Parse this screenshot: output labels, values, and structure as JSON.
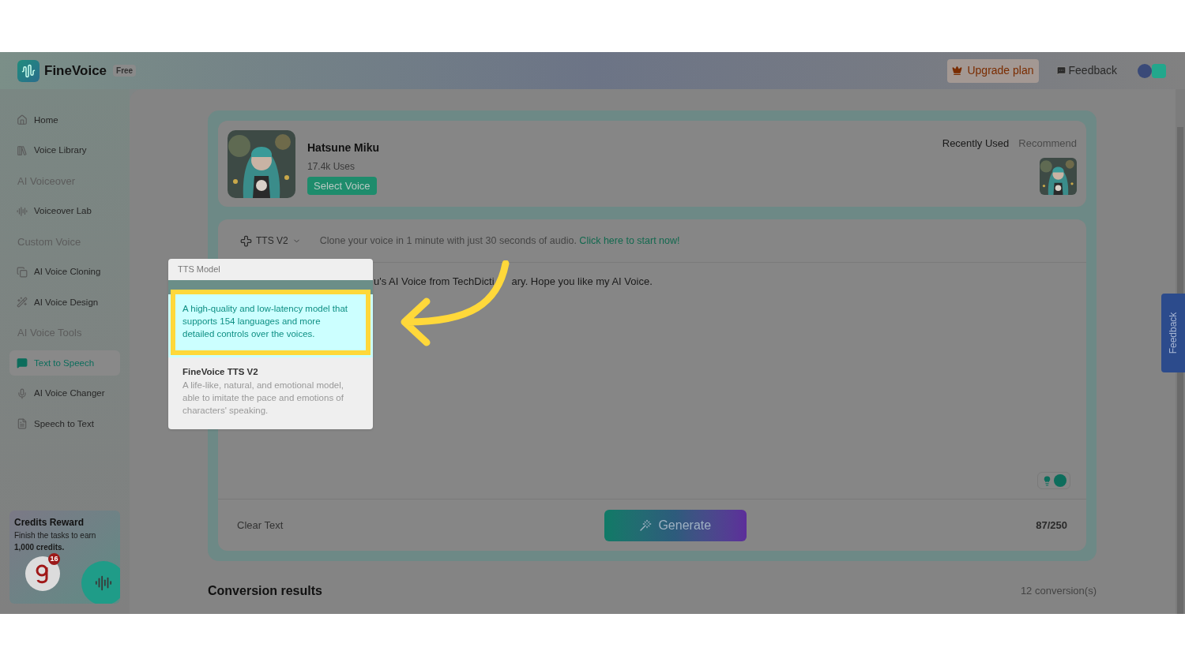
{
  "header": {
    "brand": "FineVoice",
    "plan_badge": "Free",
    "upgrade": "Upgrade plan",
    "feedback": "Feedback"
  },
  "sidebar": {
    "items": [
      {
        "kind": "link",
        "label": "Home",
        "selected": false
      },
      {
        "kind": "link",
        "label": "Voice Library",
        "selected": false
      },
      {
        "kind": "section",
        "label": "AI Voiceover"
      },
      {
        "kind": "link",
        "label": "Voiceover Lab",
        "selected": false
      },
      {
        "kind": "section",
        "label": "Custom Voice"
      },
      {
        "kind": "link",
        "label": "AI Voice Cloning",
        "selected": false
      },
      {
        "kind": "link",
        "label": "AI Voice Design",
        "selected": false
      },
      {
        "kind": "section",
        "label": "AI Voice Tools"
      },
      {
        "kind": "link",
        "label": "Text to Speech",
        "selected": true
      },
      {
        "kind": "link",
        "label": "AI Voice Changer",
        "selected": false
      },
      {
        "kind": "link",
        "label": "Speech to Text",
        "selected": false
      }
    ]
  },
  "credits": {
    "title": "Credits Reward",
    "text": "Finish the tasks to earn **1,000 credits.**",
    "badge": "16"
  },
  "voice": {
    "name": "Hatsune Miku",
    "uses": "17.4k Uses",
    "select": "Select Voice",
    "tabs": [
      {
        "label": "Recently Used",
        "selected": true
      },
      {
        "label": "Recommend",
        "selected": false
      }
    ]
  },
  "editor": {
    "model": "TTS V2",
    "promo": "Clone your voice in 1 minute with just 30 seconds of audio.",
    "promo_link": "Click here to start now!",
    "text_parts": [
      "u's AI Voice from TechDicti",
      "ary. Hope you like my AI Voice."
    ],
    "clear": "Clear Text",
    "generate": "Generate",
    "count": "87/250"
  },
  "results": {
    "title": "Conversion results",
    "count": "12 conversion(s)"
  },
  "dropdown": {
    "title": "TTS Model",
    "options": [
      {
        "selected": true,
        "description": "A high-quality and low-latency model that supports 154 languages and more detailed controls over the voices."
      },
      {
        "selected": false,
        "title": "FineVoice TTS V2",
        "description": "A life-like, natural, and emotional model, able to imitate the pace and emotions of characters' speaking."
      }
    ]
  },
  "side_tab": "Feedback"
}
